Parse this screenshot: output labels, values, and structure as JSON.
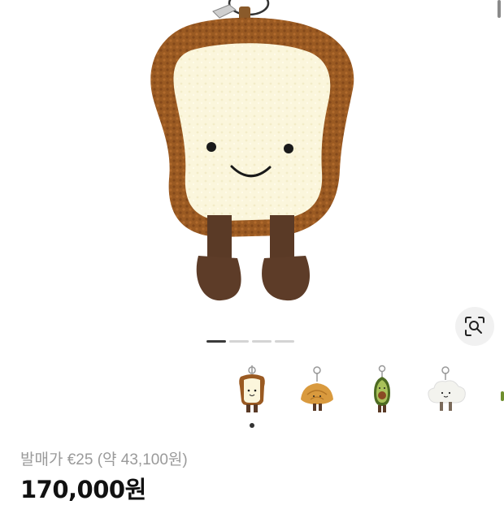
{
  "product": {
    "original_price_label": "발매가 €25 (약 43,100원)",
    "price": "170,000원"
  },
  "gallery": {
    "slide_count": 4,
    "active_slide": 1,
    "thumbnails": [
      "toast",
      "croissant",
      "avocado",
      "cloud",
      "more"
    ],
    "selected_thumbnail": 1
  },
  "icons": {
    "image_search": "lens-search-icon"
  },
  "colors": {
    "crust": "#9a5a22",
    "bread": "#fbf6dc",
    "legs": "#5a3a26",
    "active_dot": "#3a3a3a",
    "inactive_dot": "#d4d4d4",
    "price_text": "#111111",
    "muted_text": "#9a9a9a"
  }
}
